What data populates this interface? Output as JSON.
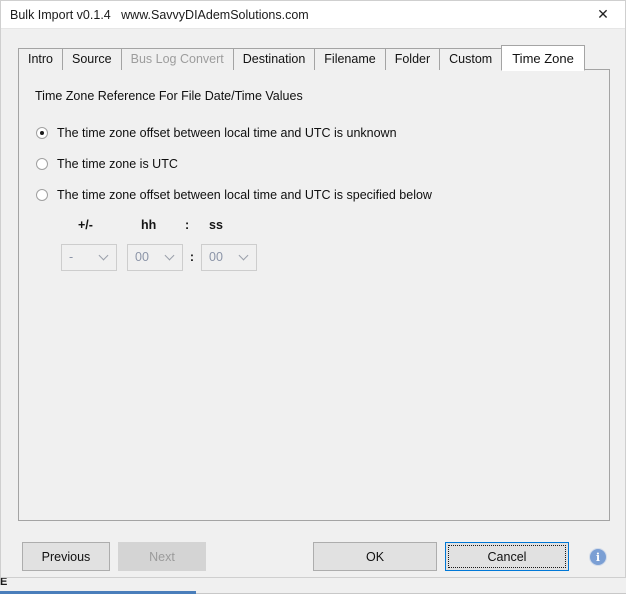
{
  "window": {
    "title": "Bulk Import v0.1.4   www.SavvyDIAdemSolutions.com",
    "close_icon": "close-icon",
    "close_glyph": "✕"
  },
  "tabs": [
    {
      "label": "Intro",
      "active": false,
      "disabled": false
    },
    {
      "label": "Source",
      "active": false,
      "disabled": false
    },
    {
      "label": "Bus Log Convert",
      "active": false,
      "disabled": true
    },
    {
      "label": "Destination",
      "active": false,
      "disabled": false
    },
    {
      "label": "Filename",
      "active": false,
      "disabled": false
    },
    {
      "label": "Folder",
      "active": false,
      "disabled": false
    },
    {
      "label": "Custom",
      "active": false,
      "disabled": false
    },
    {
      "label": "Time Zone",
      "active": true,
      "disabled": false
    }
  ],
  "panel": {
    "heading": "Time Zone Reference For File Date/Time Values",
    "options": [
      {
        "label": "The time zone offset between local time and UTC is unknown",
        "checked": true
      },
      {
        "label": "The time zone is UTC",
        "checked": false
      },
      {
        "label": "The time zone offset between local time and UTC is specified below",
        "checked": false
      }
    ],
    "offset": {
      "label_sign": "+/-",
      "label_hh": "hh",
      "label_colon": ":",
      "label_ss": "ss",
      "separator": ":",
      "sign_value": "-",
      "hh_value": "00",
      "ss_value": "00",
      "enabled": false
    }
  },
  "buttons": {
    "previous": "Previous",
    "next": "Next",
    "ok": "OK",
    "cancel": "Cancel"
  },
  "info": {
    "icon": "info-icon",
    "glyph": "i"
  },
  "colors": {
    "window_bg": "#f0f0f0",
    "titlebar_bg": "#ffffff",
    "active_tab_bg": "#ffffff",
    "panel_border": "#a4a4a4",
    "button_bg": "#e1e1e1",
    "focus_accent": "#0078d7",
    "disabled_text": "#9d9d9d",
    "info_icon_bg": "#7b9fd4",
    "bg_task_accent": "#4a7ebb"
  }
}
